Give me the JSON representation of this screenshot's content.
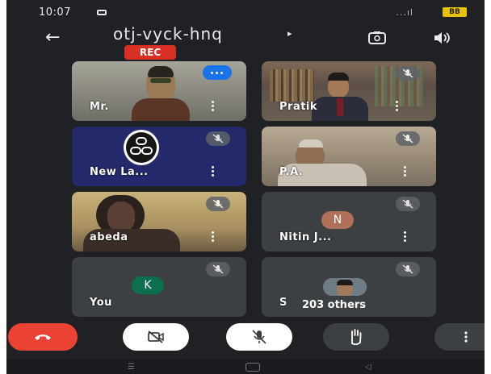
{
  "status_bar": {
    "time": "10:07",
    "signal": "...ıl",
    "battery": "BB"
  },
  "meeting": {
    "code": "otj-vyck-hnq",
    "code_arrow": "▸",
    "recording_label": "REC"
  },
  "participants": [
    {
      "name": "Mr.",
      "muted": false,
      "speaking": true,
      "video": true
    },
    {
      "name": "Pratik",
      "muted": true,
      "video": true
    },
    {
      "name": "New La...",
      "muted": true,
      "video": true
    },
    {
      "name": "P.A.",
      "muted": true,
      "video": true
    },
    {
      "name": "abeda",
      "muted": true,
      "video": true
    },
    {
      "name": "Nitin J...",
      "muted": true,
      "video": false,
      "initial": "N",
      "avatar_color": "#b0705a"
    },
    {
      "name": "You",
      "muted": true,
      "video": false,
      "initial": "K",
      "avatar_color": "#0d6e50"
    },
    {
      "name": "S",
      "muted": true,
      "video": true,
      "others_label": "203 others"
    }
  ],
  "controls": [
    "end-call",
    "camera-off",
    "mic-off",
    "raise-hand",
    "more-options"
  ],
  "colors": {
    "end_call": "#ea4335",
    "control_bg": "#ffffff",
    "tile_bg": "#3c4043",
    "app_bg": "#202124"
  }
}
